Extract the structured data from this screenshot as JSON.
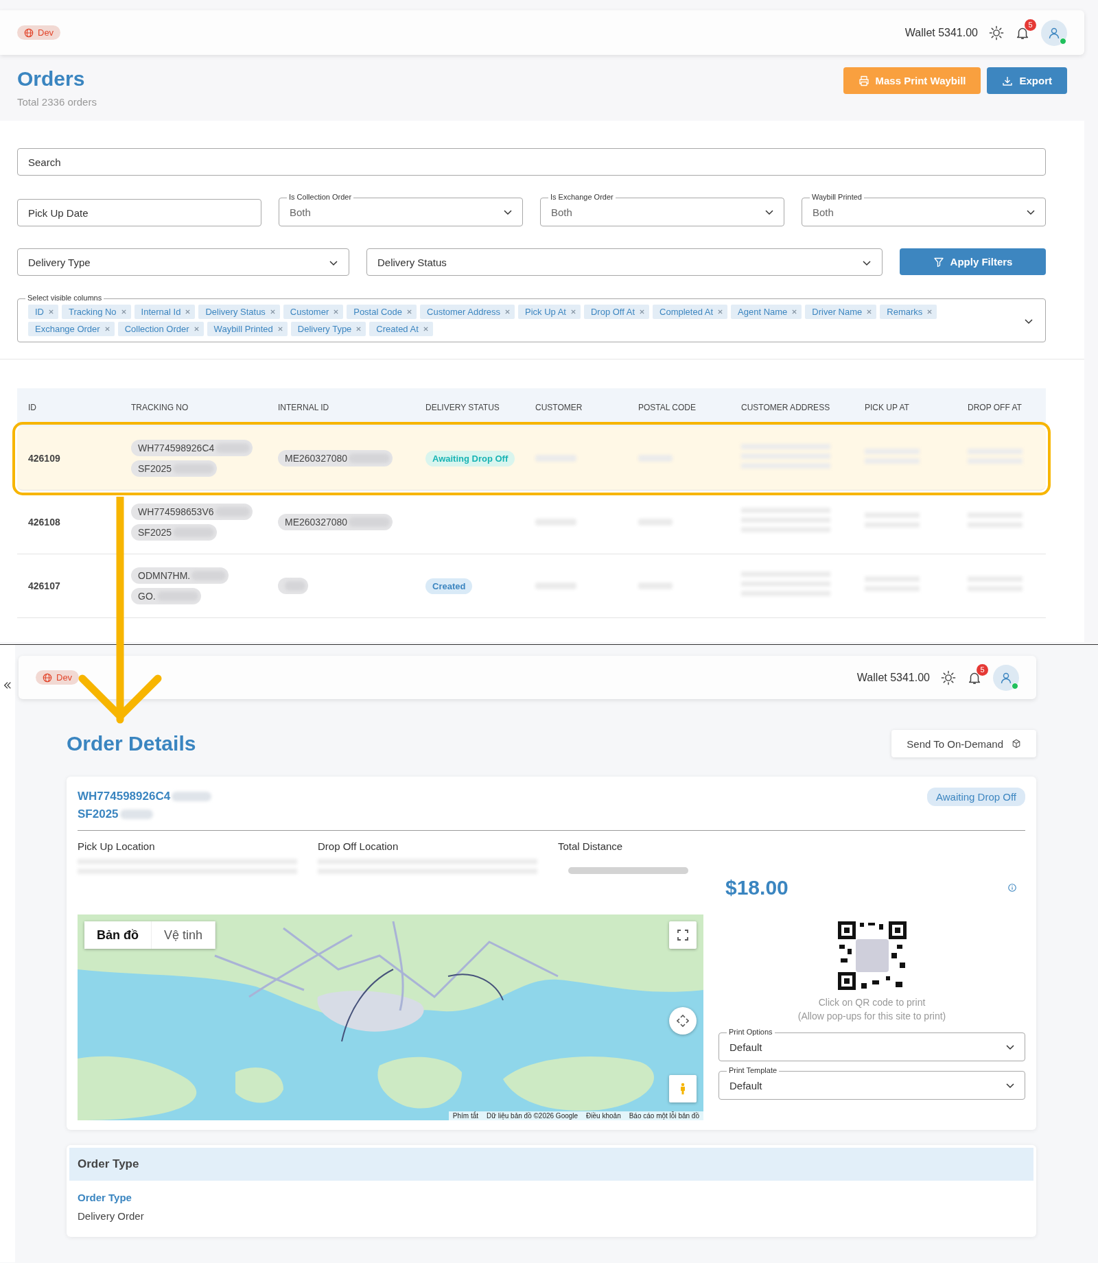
{
  "top_header": {
    "env_badge": "Dev",
    "wallet": "Wallet 5341.00",
    "notifications": "5",
    "online": true
  },
  "orders": {
    "title": "Orders",
    "subtitle": "Total 2336 orders",
    "buttons": [
      {
        "label": "Mass Print Waybill",
        "kind": "print"
      },
      {
        "label": "Export",
        "kind": "export"
      }
    ]
  },
  "filters": {
    "search": {
      "placeholder": "Search"
    },
    "row_1": [
      {
        "kind": "input",
        "placeholder": "Pick Up Date"
      },
      {
        "kind": "select",
        "label": "Is Collection Order",
        "value": "Both"
      },
      {
        "kind": "select",
        "label": "Is Exchange Order",
        "value": "Both"
      },
      {
        "kind": "select",
        "label": "Waybill Printed",
        "value": "Both"
      }
    ],
    "row_2": [
      {
        "kind": "select",
        "placeholder": "Delivery Type"
      },
      {
        "kind": "select",
        "placeholder": "Delivery Status"
      }
    ],
    "apply_button": "Apply Filters",
    "visible_columns": {
      "label": "Select visible columns",
      "tags": [
        "ID",
        "Tracking No",
        "Internal Id",
        "Delivery Status",
        "Customer",
        "Postal Code",
        "Customer Address",
        "Pick Up At",
        "Drop Off At",
        "Completed At",
        "Agent Name",
        "Driver Name",
        "Remarks",
        "Exchange Order",
        "Collection Order",
        "Waybill Printed",
        "Delivery Type",
        "Created At"
      ]
    }
  },
  "table": {
    "columns": [
      "ID",
      "TRACKING NO",
      "INTERNAL ID",
      "DELIVERY STATUS",
      "CUSTOMER",
      "POSTAL CODE",
      "CUSTOMER ADDRESS",
      "PICK UP AT",
      "DROP OFF AT"
    ],
    "rows": [
      {
        "id": "426109",
        "tracking": [
          "WH774598926C4",
          "SF2025"
        ],
        "internal_id": "ME260327080",
        "status": {
          "label": "Awaiting Drop Off",
          "kind": "awaiting"
        },
        "highlighted": true
      },
      {
        "id": "426108",
        "tracking": [
          "WH774598653V6",
          "SF2025"
        ],
        "internal_id": "ME260327080",
        "highlighted": false
      },
      {
        "id": "426107",
        "tracking": [
          "ODMN7HM.",
          "GO."
        ],
        "status": {
          "label": "Created",
          "kind": "created"
        },
        "highlighted": false
      }
    ]
  },
  "detail_header": {
    "env_badge": "Dev",
    "wallet": "Wallet 5341.00",
    "notifications": "5",
    "online": true
  },
  "details": {
    "title": "Order Details",
    "send_button": "Send To On-Demand",
    "tracking": [
      "WH774598926C4",
      "SF2025"
    ],
    "status": {
      "label": "Awaiting Drop Off",
      "kind": "awaiting"
    },
    "fields": [
      "Pick Up Location",
      "Drop Off Location",
      "Total Distance"
    ],
    "price": "$18.00",
    "qr_caption": [
      "Click on QR code to print",
      "(Allow pop-ups for this site to print)"
    ],
    "selects": [
      {
        "label": "Print Options",
        "value": "Default"
      },
      {
        "label": "Print Template",
        "value": "Default"
      }
    ],
    "map": {
      "tabs": [
        {
          "label": "Bản đồ",
          "selected": true
        },
        {
          "label": "Vệ tinh",
          "selected": false
        }
      ],
      "attribution": [
        "Phím tắt",
        "Dữ liệu bản đồ ©2026 Google",
        "Điều khoản",
        "Báo cáo một lỗi bản đồ"
      ]
    }
  },
  "order_type": {
    "header": "Order Type",
    "label": "Order Type",
    "value": "Delivery Order"
  }
}
